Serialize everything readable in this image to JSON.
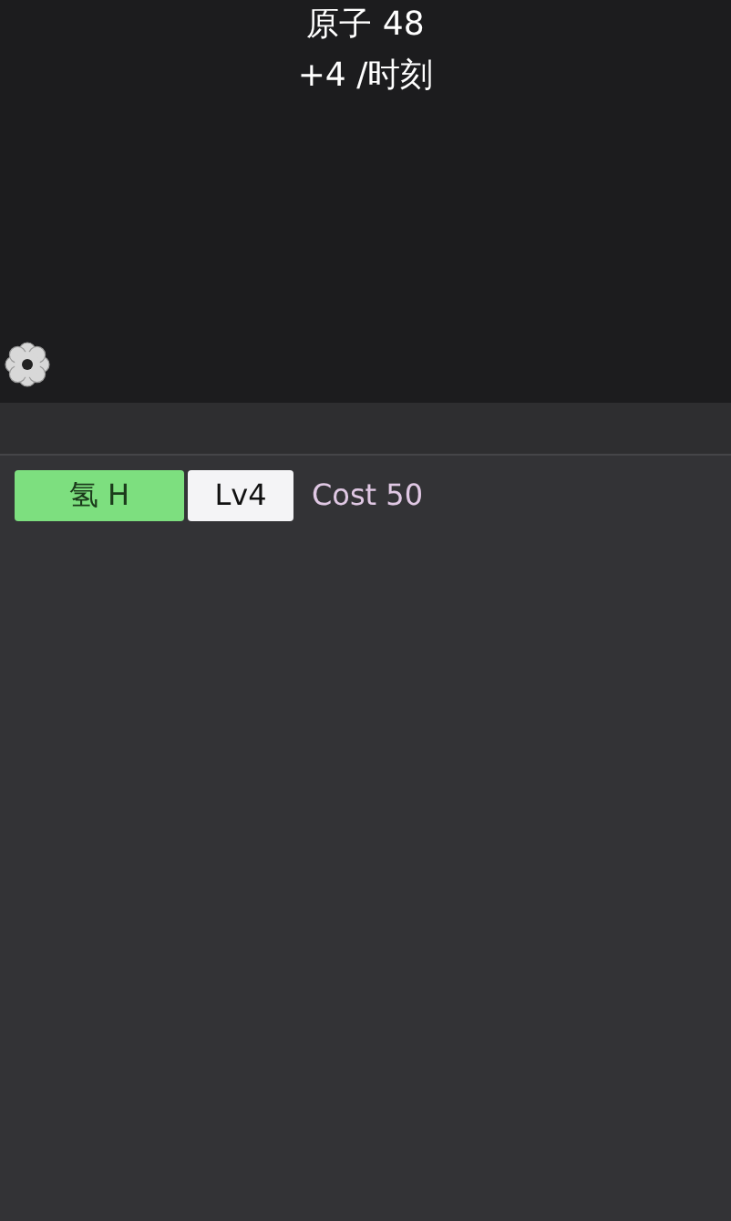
{
  "header": {
    "resource": "原子 48",
    "rate": "+4 /时刻"
  },
  "elements": [
    {
      "name": "氢 H",
      "level": "Lv4",
      "cost": "Cost 50",
      "selected": true
    }
  ]
}
